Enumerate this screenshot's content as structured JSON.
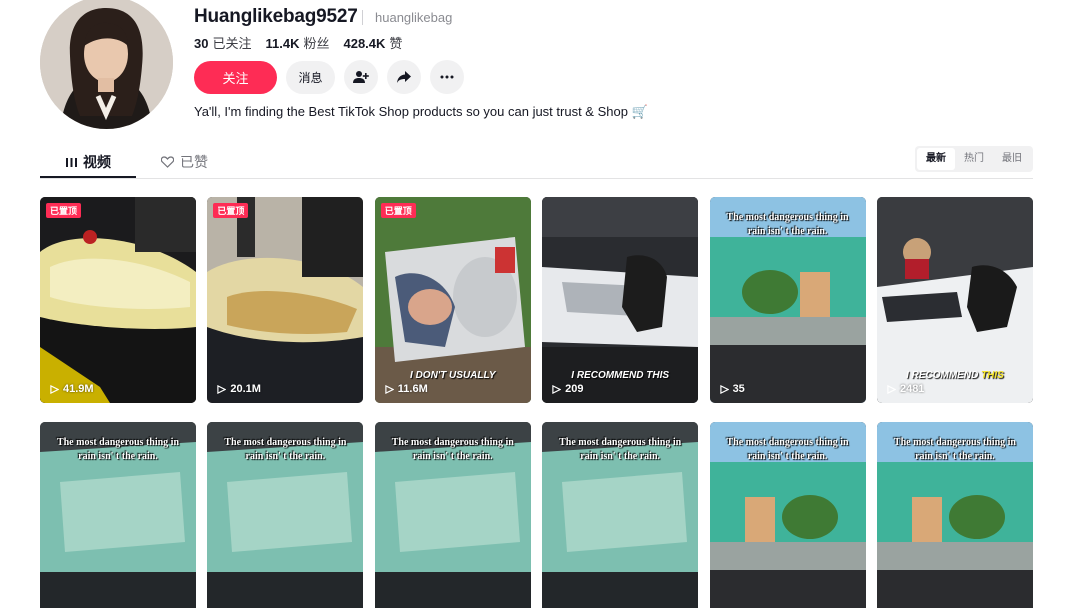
{
  "profile": {
    "username": "Huanglikebag9527",
    "handle": "huanglikebag",
    "stats": [
      {
        "num": "30",
        "label": "已关注"
      },
      {
        "num": "11.4K",
        "label": "粉丝"
      },
      {
        "num": "428.4K",
        "label": "赞"
      }
    ],
    "follow_label": "关注",
    "message_label": "消息",
    "bio": "Ya'll, I'm finding the Best TikTok Shop products so you can just trust & Shop 🛒"
  },
  "tabs": {
    "videos_label": "视频",
    "liked_label": "已赞",
    "sort": [
      "最新",
      "热门",
      "最旧"
    ]
  },
  "videos": [
    {
      "pinned": "已置顶",
      "views": "41.9M",
      "caption": "",
      "overlay": ""
    },
    {
      "pinned": "已置顶",
      "views": "20.1M",
      "caption": "",
      "overlay": ""
    },
    {
      "pinned": "已置顶",
      "views": "11.6M",
      "caption": "",
      "overlay": "I DON'T USUALLY"
    },
    {
      "pinned": "",
      "views": "209",
      "caption": "",
      "overlay": "I RECOMMEND THIS"
    },
    {
      "pinned": "",
      "views": "35",
      "caption": "The most dangerous thing in rain isn' t the rain.",
      "overlay": ""
    },
    {
      "pinned": "",
      "views": "2481",
      "caption": "",
      "overlay_a": "I RECOMMEND ",
      "overlay_b": "THIS"
    },
    {
      "pinned": "",
      "views": "",
      "caption": "The most dangerous thing in rain isn' t the rain.",
      "overlay": ""
    },
    {
      "pinned": "",
      "views": "",
      "caption": "The most dangerous thing in rain isn' t the rain.",
      "overlay": ""
    },
    {
      "pinned": "",
      "views": "",
      "caption": "The most dangerous thing in rain isn' t the rain.",
      "overlay": ""
    },
    {
      "pinned": "",
      "views": "",
      "caption": "The most dangerous thing in rain isn' t the rain.",
      "overlay": ""
    },
    {
      "pinned": "",
      "views": "",
      "caption": "The most dangerous thing in rain isn' t the rain.",
      "overlay": ""
    },
    {
      "pinned": "",
      "views": "",
      "caption": "The most dangerous thing in rain isn' t the rain.",
      "overlay": ""
    }
  ],
  "colors": {
    "accent": "#fe2c55",
    "text": "#161823"
  }
}
